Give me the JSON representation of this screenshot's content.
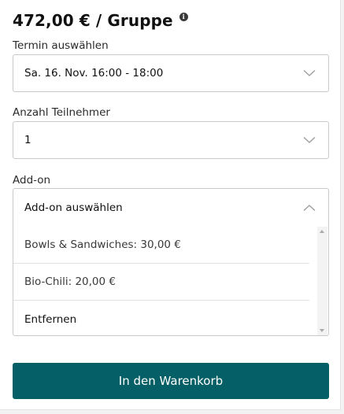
{
  "price": {
    "text": "472,00 € / Gruppe",
    "info_icon_glyph": "i"
  },
  "date_select": {
    "label": "Termin auswählen",
    "value": "Sa. 16. Nov. 16:00 - 18:00",
    "icon": "chevron-down-icon"
  },
  "participants_select": {
    "label": "Anzahl Teilnehmer",
    "value": "1",
    "icon": "chevron-down-icon"
  },
  "addon_select": {
    "label": "Add-on",
    "value": "Add-on auswählen",
    "icon": "chevron-up-icon",
    "options": [
      {
        "label": "Bowls & Sandwiches: 30,00 €"
      },
      {
        "label": "Bio-Chili: 20,00 €"
      },
      {
        "label": "Entfernen"
      }
    ]
  },
  "cart_button": {
    "label": "In den Warenkorb"
  },
  "colors": {
    "primary_button": "#046066",
    "border": "#c9c9c9",
    "text": "#111111"
  }
}
